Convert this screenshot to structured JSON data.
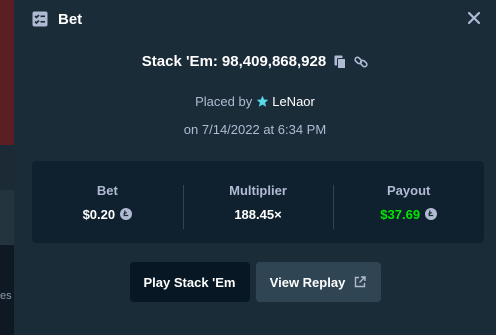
{
  "background": {
    "partial_text": "es"
  },
  "modal": {
    "title": "Bet",
    "game_name": "Stack 'Em:",
    "bet_id": "98,409,868,928",
    "placed_by_label": "Placed by",
    "username": "LeNaor",
    "date_line": "on 7/14/2022 at 6:34 PM"
  },
  "stats": [
    {
      "label": "Bet",
      "value": "$0.20",
      "icon": "litecoin-icon"
    },
    {
      "label": "Multiplier",
      "value": "188.45×"
    },
    {
      "label": "Payout",
      "value": "$37.69",
      "icon": "litecoin-icon"
    }
  ],
  "buttons": {
    "play_label": "Play Stack 'Em",
    "replay_label": "View Replay"
  },
  "colors": {
    "modal_bg": "#1a2c38",
    "panel_bg": "#0f212e",
    "text_muted": "#b1bad3",
    "payout_green": "#00e701",
    "button_dark": "#071824",
    "button_grey": "#2f4553",
    "star_teal": "#57d9e8"
  }
}
